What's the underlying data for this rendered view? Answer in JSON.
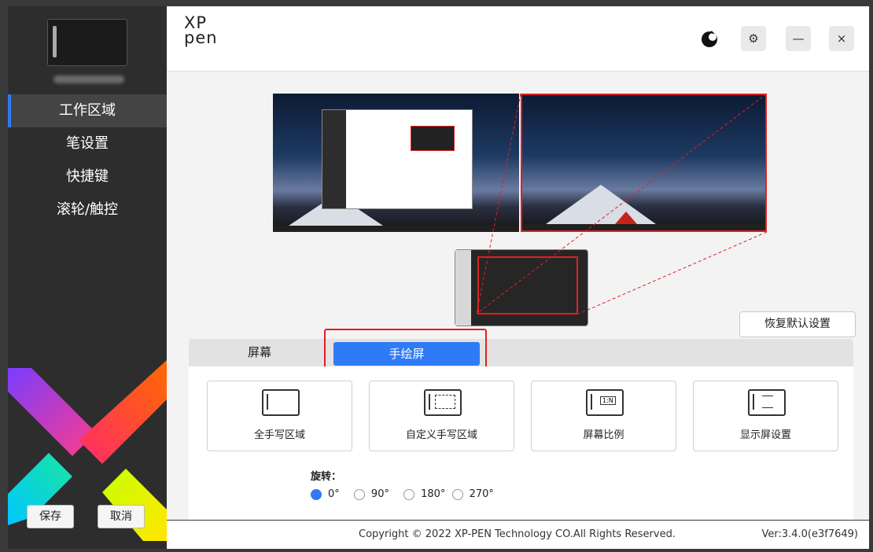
{
  "colors": {
    "accent": "#2f7bf6",
    "highlight_red": "#e02020",
    "sidebar_bg": "#2d2d2d"
  },
  "app": {
    "logo_top": "XP",
    "logo_bottom": "pen"
  },
  "header": {
    "icons": [
      "theme-icon",
      "settings-icon",
      "minimize-icon",
      "close-icon"
    ],
    "minimize_label": "—",
    "close_label": "×",
    "settings_label": "⚙"
  },
  "sidebar": {
    "items": [
      {
        "label": "工作区域",
        "active": true
      },
      {
        "label": "笔设置",
        "active": false
      },
      {
        "label": "快捷键",
        "active": false
      },
      {
        "label": "滚轮/触控",
        "active": false
      }
    ],
    "save_label": "保存",
    "cancel_label": "取消"
  },
  "workspace": {
    "reset_label": "恢复默认设置",
    "tabs": [
      {
        "label": "屏幕",
        "active": false
      },
      {
        "label": "手绘屏",
        "active": true
      }
    ],
    "cards": [
      {
        "label": "全手写区域",
        "icon": "full-area-icon"
      },
      {
        "label": "自定义手写区域",
        "icon": "custom-area-icon"
      },
      {
        "label": "屏幕比例",
        "icon": "screen-ratio-icon",
        "icon_text": "1:N"
      },
      {
        "label": "显示屏设置",
        "icon": "display-settings-icon"
      }
    ],
    "rotation": {
      "title": "旋转：",
      "options": [
        "0°",
        "90°",
        "180°",
        "270°"
      ],
      "selected": "0°"
    }
  },
  "footer": {
    "copyright": "Copyright © 2022  XP-PEN Technology CO.All Rights Reserved.",
    "version": "Ver:3.4.0(e3f7649)"
  }
}
